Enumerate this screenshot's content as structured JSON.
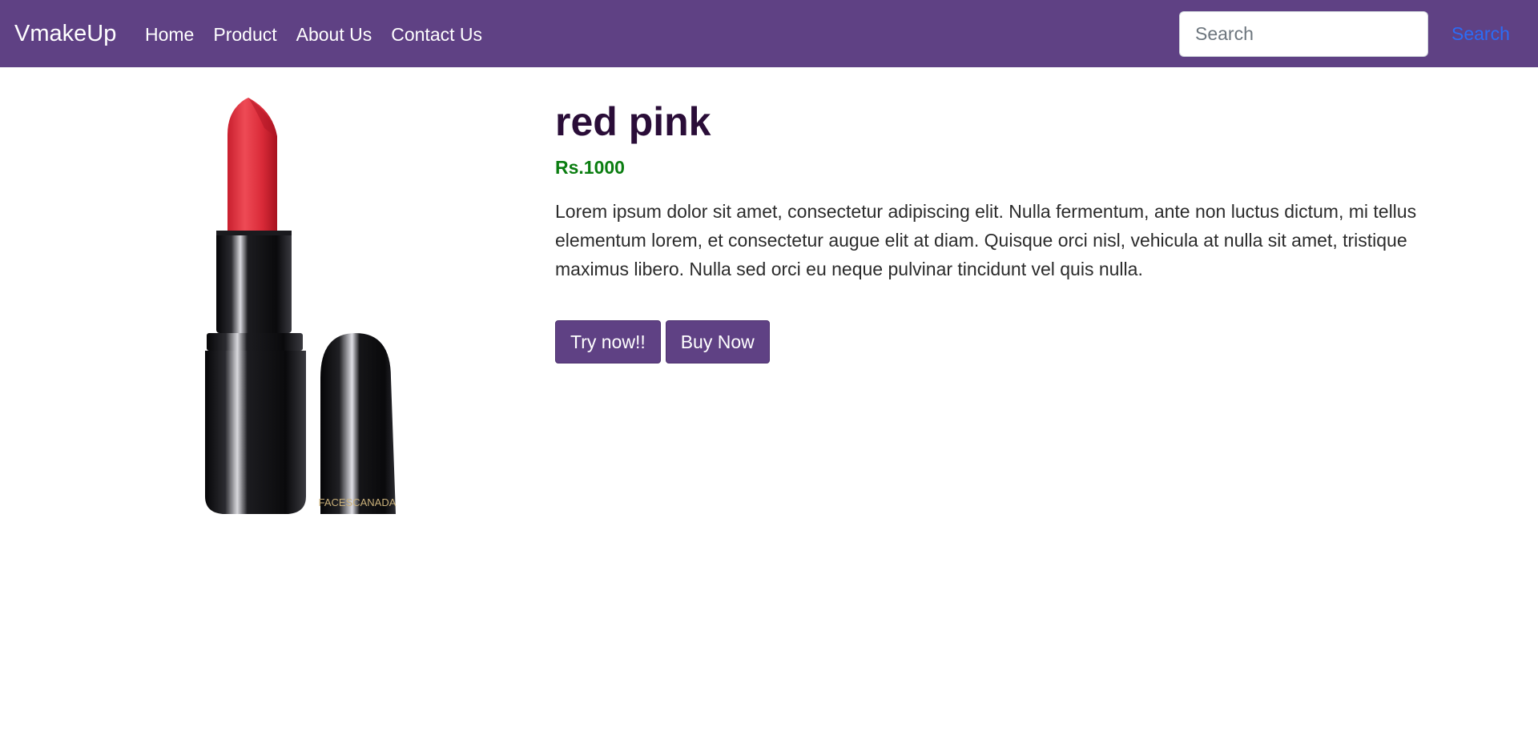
{
  "navbar": {
    "brand": "VmakeUp",
    "links": [
      {
        "label": "Home"
      },
      {
        "label": "Product"
      },
      {
        "label": "About Us"
      },
      {
        "label": "Contact Us"
      }
    ],
    "search": {
      "placeholder": "Search",
      "value": "",
      "button_label": "Search"
    },
    "colors": {
      "background": "#5f4184",
      "search_button_text": "#2b6cf6"
    }
  },
  "product": {
    "name": "red pink",
    "price": "Rs.1000",
    "description": "Lorem ipsum dolor sit amet, consectetur adipiscing elit. Nulla fermentum, ante non luctus dictum, mi tellus elementum lorem, et consectetur augue elit at diam. Quisque orci nisl, vehicula at nulla sit amet, tristique maximus libero. Nulla sed orci eu neque pulvinar tincidunt vel quis nulla.",
    "image": {
      "subject": "lipstick",
      "brand_text": "FACESCANADA"
    },
    "buttons": {
      "try": "Try now!!",
      "buy": "Buy Now"
    },
    "colors": {
      "price": "#0a7d10",
      "title": "#2a0d38",
      "button": "#5f4184"
    }
  }
}
